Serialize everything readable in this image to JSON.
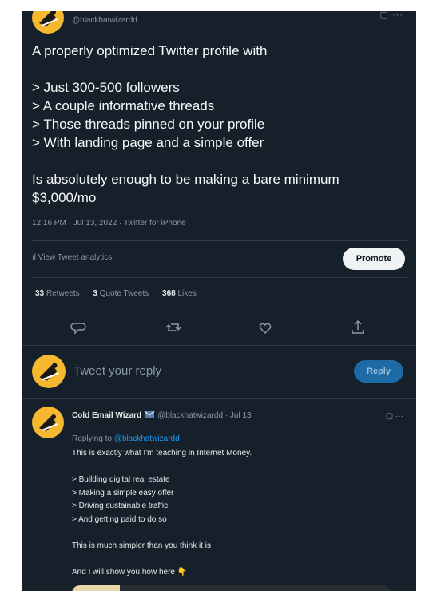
{
  "tweet": {
    "handle": "@blackhatwizardd",
    "text": "A properly optimized Twitter profile with\n\n> Just 300-500 followers\n> A couple informative threads\n> Those threads pinned on your profile\n> With landing page and a simple offer\n\nIs absolutely enough to be making a bare minimum\n$3,000/mo",
    "meta": "12:16 PM · Jul 13, 2022 · Twitter for iPhone",
    "analytics_label": "View Tweet analytics",
    "promote_label": "Promote",
    "stats": {
      "retweets_count": "33",
      "retweets_label": "Retweets",
      "quotes_count": "3",
      "quotes_label": "Quote Tweets",
      "likes_count": "368",
      "likes_label": "Likes"
    },
    "actions": [
      "reply-icon",
      "retweet-icon",
      "like-icon",
      "share-icon"
    ]
  },
  "reply_composer": {
    "placeholder": "Tweet your reply",
    "button_label": "Reply"
  },
  "reply_tweet": {
    "name": "Cold Email Wizard",
    "handle": "@blackhatwizardd",
    "date": "· Jul 13",
    "replying_prefix": "Replying to",
    "replying_to": "@blackhatwizardd",
    "text": "This is exactly what I'm teaching in Internet Money.\n\n> Building digital real estate\n> Making a simple easy offer\n> Driving sustainable traffic\n> And getting paid to do so\n\nThis is much simpler than you think it is\n\nAnd I will show you how here 👇"
  },
  "colors": {
    "background": "#15202b",
    "text": "#e7e9ea",
    "muted": "#8b98a5",
    "accent": "#1d9bf0",
    "avatar": "#f5b82e"
  }
}
